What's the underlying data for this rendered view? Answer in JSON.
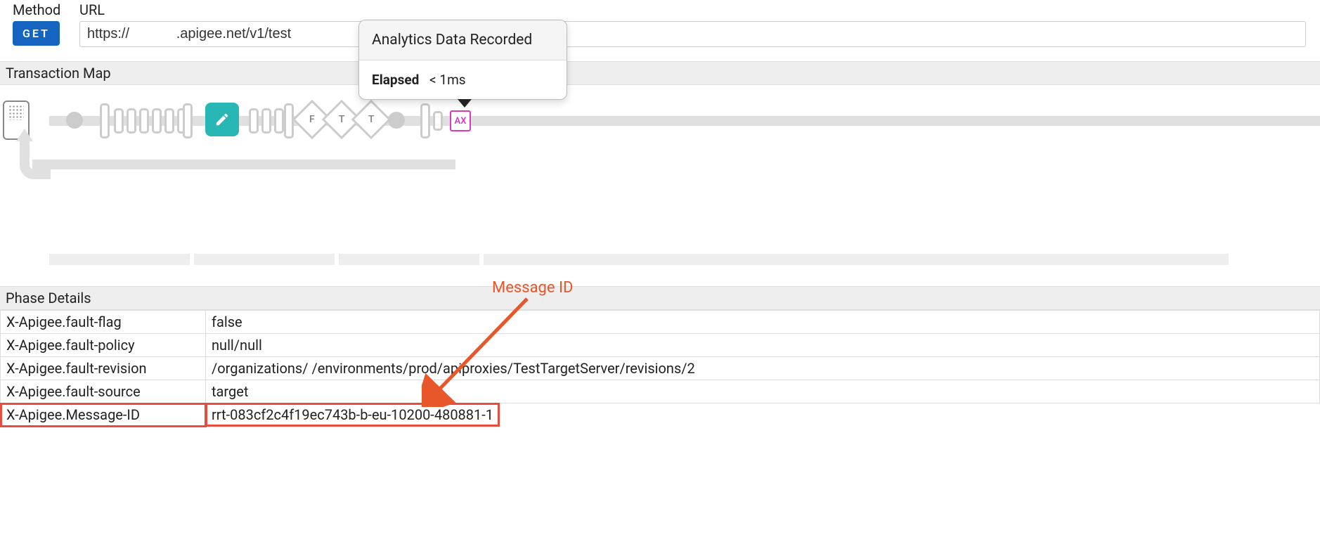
{
  "header": {
    "method_label": "Method",
    "url_label": "URL",
    "method": "GET",
    "url": "https://            .apigee.net/v1/test"
  },
  "transaction_map": {
    "title": "Transaction Map",
    "diamonds": [
      "F",
      "T",
      "T"
    ],
    "ax_label": "AX"
  },
  "tooltip": {
    "title": "Analytics Data Recorded",
    "elapsed_label": "Elapsed",
    "elapsed_value": "< 1ms"
  },
  "phase": {
    "title": "Phase Details",
    "rows": [
      {
        "k": "X-Apigee.fault-flag",
        "v": "false"
      },
      {
        "k": "X-Apigee.fault-policy",
        "v": "null/null"
      },
      {
        "k": "X-Apigee.fault-revision",
        "v": "/organizations/           /environments/prod/apiproxies/TestTargetServer/revisions/2"
      },
      {
        "k": "X-Apigee.fault-source",
        "v": "target"
      },
      {
        "k": "X-Apigee.Message-ID",
        "v": "rrt-083cf2c4f19ec743b-b-eu-10200-480881-1"
      }
    ]
  },
  "annotation": {
    "label": "Message ID"
  }
}
